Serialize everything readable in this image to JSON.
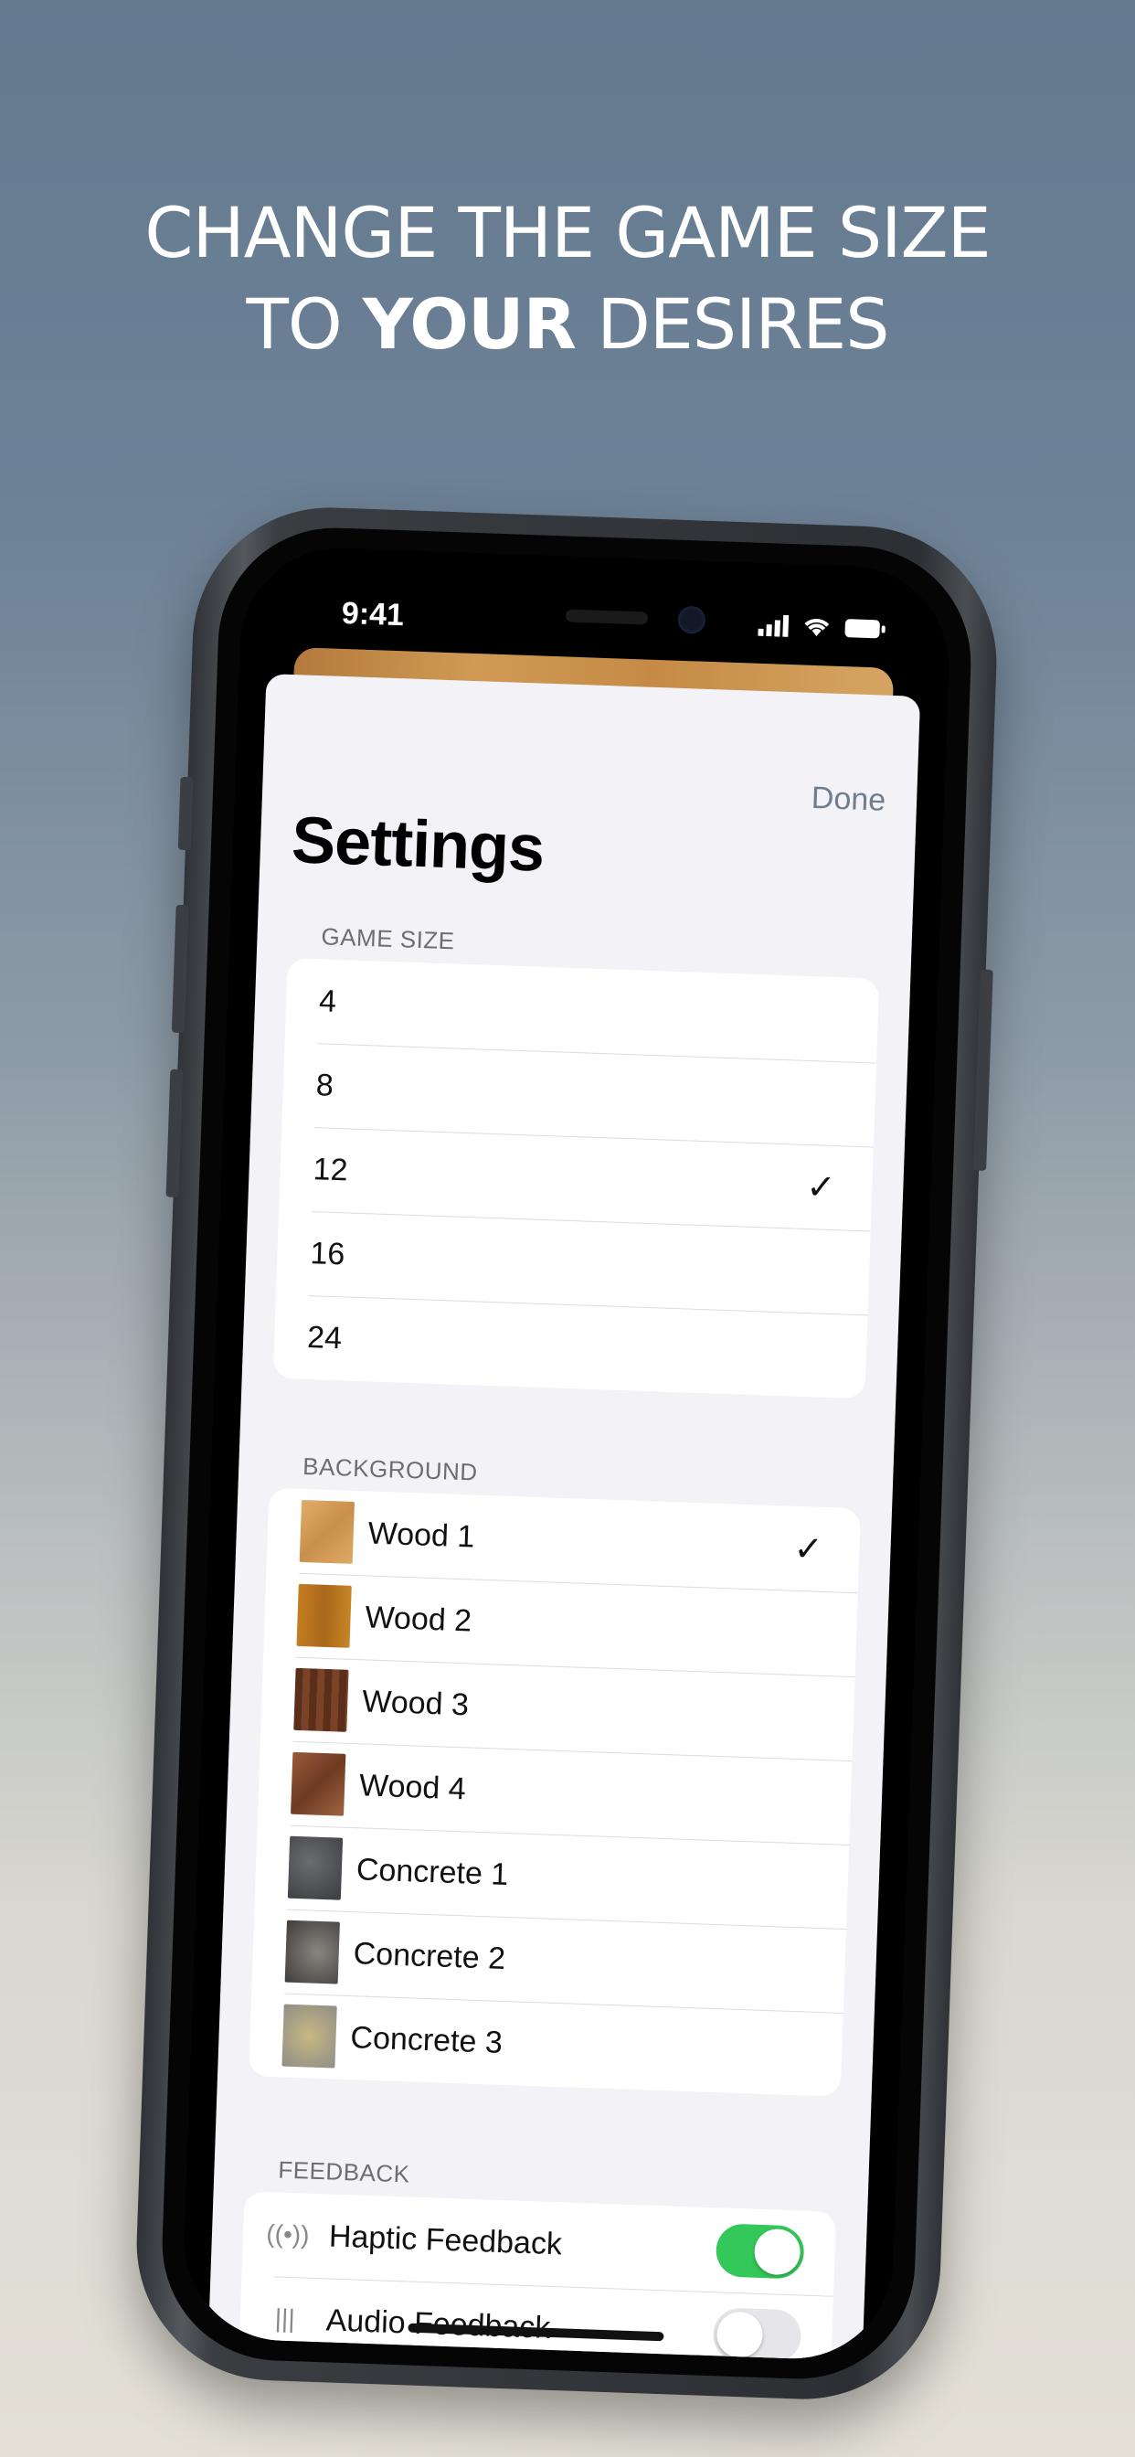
{
  "headline": {
    "line1": "CHANGE THE GAME SIZE",
    "line2_pre": "TO ",
    "line2_bold": "YOUR",
    "line2_post": " DESIRES"
  },
  "status_bar": {
    "time": "9:41"
  },
  "nav": {
    "done_label": "Done",
    "title": "Settings"
  },
  "game_size": {
    "header": "GAME SIZE",
    "options": [
      "4",
      "8",
      "12",
      "16",
      "24"
    ],
    "selected": "12"
  },
  "background": {
    "header": "BACKGROUND",
    "options": [
      {
        "label": "Wood 1",
        "color": "#d9a15d"
      },
      {
        "label": "Wood 2",
        "color": "#b9781f"
      },
      {
        "label": "Wood 3",
        "color": "#6b3a22"
      },
      {
        "label": "Wood 4",
        "color": "#8a4f33"
      },
      {
        "label": "Concrete 1",
        "color": "#4b4d50"
      },
      {
        "label": "Concrete 2",
        "color": "#5f5c58"
      },
      {
        "label": "Concrete 3",
        "color": "#b9ad86"
      }
    ],
    "selected": "Wood 1"
  },
  "feedback": {
    "header": "FEEDBACK",
    "haptic_label": "Haptic Feedback",
    "haptic_on": true,
    "audio_label": "Audio Feedback",
    "audio_on": false
  },
  "colors": {
    "accent_green": "#34c759",
    "checkmark": "✓"
  }
}
